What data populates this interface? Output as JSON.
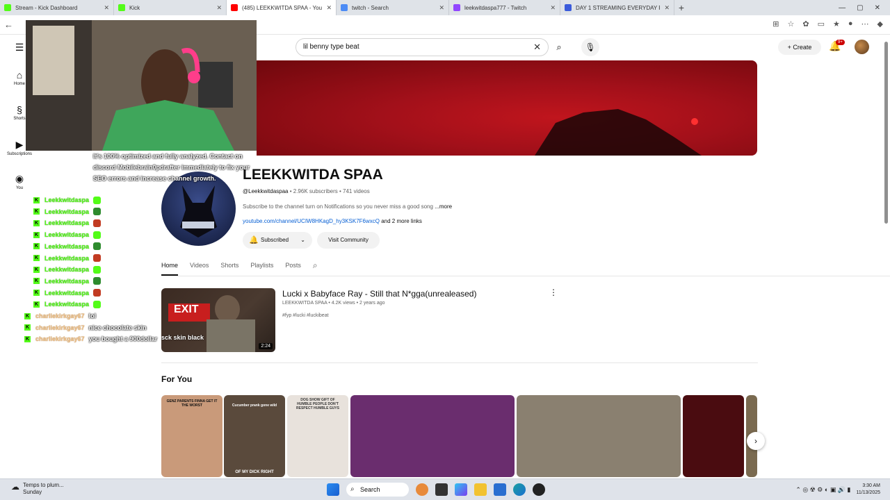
{
  "browser": {
    "tabs": [
      {
        "title": "Stream - Kick Dashboard",
        "color": "#53fc18",
        "active": false
      },
      {
        "title": "Kick",
        "color": "#53fc18",
        "active": false
      },
      {
        "title": "(485) LEEKKWITDA SPAA - YouTub",
        "color": "#ff0000",
        "active": true
      },
      {
        "title": "twitch - Search",
        "color": "#4c8bf5",
        "active": false
      },
      {
        "title": "leekwitdaspa777 - Twitch",
        "color": "#9146ff",
        "active": false
      },
      {
        "title": "DAY 1 STREAMING EVERYDAY FO",
        "color": "#3b5bdb",
        "active": false
      }
    ],
    "new_tab": "+",
    "close_glyph": "✕"
  },
  "sidebar": {
    "items": [
      {
        "label": "",
        "icon": "menu-icon"
      },
      {
        "label": "Home",
        "icon": "home-icon"
      },
      {
        "label": "Shorts",
        "icon": "shorts-icon"
      },
      {
        "label": "Subscriptions",
        "icon": "subscriptions-icon"
      },
      {
        "label": "You",
        "icon": "you-icon"
      }
    ]
  },
  "header": {
    "search_value": "lil benny type beat",
    "create_label": "Create",
    "notif_badge": "9+"
  },
  "channel": {
    "name": "LEEKKWITDA SPAA",
    "handle": "@Leekkwitdaspaa",
    "stats": " • 2.96K subscribers • 741 videos",
    "description": "Subscribe to the channel turn on Notifications so you never miss a good song ",
    "more": "...more",
    "link": "youtube.com/channel/UCIW8HKagD_hy3KSK7F6wxcQ",
    "more_links": " and 2 more links",
    "subscribed_label": "Subscribed",
    "community_label": "Visit Community",
    "tabs": [
      "Home",
      "Videos",
      "Shorts",
      "Playlists",
      "Posts"
    ]
  },
  "featured": {
    "title": "Lucki x Babyface Ray - Still that N*gga(unrealeased)",
    "meta": "LEEKKWITDA SPAA • 4.2K views • 2 years ago",
    "tags": "#fyp #lucki #luckibeat",
    "duration": "2:24",
    "thumb_caption": "sck skin black",
    "thumb_sign": "EXIT"
  },
  "for_you": {
    "title": "For You",
    "cards": [
      {
        "text": "GENZ PARENTS FINNA GET IT THE WORST",
        "bg": "#c99a7a"
      },
      {
        "text": "Cucumber prank gone wild",
        "bg": "#5a4a3c"
      },
      {
        "text": "DOG SHOW GIFT OF HUMBLE PEOPLE DON'T RESPECT HUMBLE GUYS",
        "bg": "#e8e2dc"
      },
      {
        "text": "",
        "bg": "#6a2d6e"
      },
      {
        "text": "",
        "bg": "#8a8070"
      },
      {
        "text": "",
        "bg": "#4a0c10"
      },
      {
        "text": "",
        "bg": "#7a6a50"
      }
    ],
    "caption_of_my_dick": "OF MY DICK RIGHT"
  },
  "chat": {
    "overlay_text": "It's 100% optimized and fully analyzed. Contact on discord Mobilebrain0pdrafter immediately to fix your SEO errors and increase channel growth.",
    "lines": [
      {
        "name": "Leekkwitdaspa",
        "msg": "",
        "emote": "#53fc18",
        "peach": false
      },
      {
        "name": "Leekkwitdaspa",
        "msg": "",
        "emote": "#2e8b2e",
        "peach": false
      },
      {
        "name": "Leekkwitdaspa",
        "msg": "",
        "emote": "#c23b22",
        "peach": false
      },
      {
        "name": "Leekkwitdaspa",
        "msg": "",
        "emote": "#53fc18",
        "peach": false
      },
      {
        "name": "Leekkwitdaspa",
        "msg": "",
        "emote": "#2e8b2e",
        "peach": false
      },
      {
        "name": "Leekkwitdaspa",
        "msg": "",
        "emote": "#c23b22",
        "peach": false
      },
      {
        "name": "Leekkwitdaspa",
        "msg": "",
        "emote": "#53fc18",
        "peach": false
      },
      {
        "name": "Leekkwitdaspa",
        "msg": "",
        "emote": "#2e8b2e",
        "peach": false
      },
      {
        "name": "Leekkwitdaspa",
        "msg": "",
        "emote": "#c23b22",
        "peach": false
      },
      {
        "name": "Leekkwitdaspa",
        "msg": "",
        "emote": "#53fc18",
        "peach": false
      },
      {
        "name": "charliekirkgay67",
        "msg": "lol",
        "emote": "",
        "peach": true
      },
      {
        "name": "charliekirkgay67",
        "msg": "nice chocolate skin",
        "emote": "",
        "peach": true
      },
      {
        "name": "charliekirkgay67",
        "msg": "you bought a 900dollar",
        "emote": "",
        "peach": true
      }
    ],
    "kick_glyph": "K"
  },
  "taskbar": {
    "weather_title": "Temps to plum...",
    "weather_sub": "Sunday",
    "search_label": "Search",
    "time": "3:30 AM",
    "date": "11/13/2025"
  },
  "colors": {
    "kick_green": "#53fc18",
    "youtube_red": "#ff0000",
    "link_blue": "#065fd4"
  }
}
